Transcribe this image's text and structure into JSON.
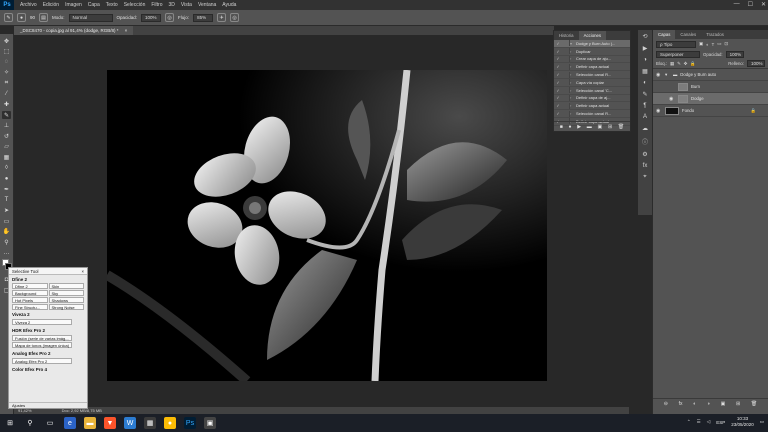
{
  "menubar": {
    "logo": "Ps",
    "items": [
      "Archivo",
      "Edición",
      "Imagen",
      "Capa",
      "Texto",
      "Selección",
      "Filtro",
      "3D",
      "Vista",
      "Ventana",
      "Ayuda"
    ],
    "window_controls": [
      "—",
      "☐",
      "✕"
    ]
  },
  "options": {
    "mode_label": "Modo:",
    "mode_value": "Normal",
    "opacity_label": "Opacidad:",
    "opacity_value": "100%",
    "flow_label": "Flujo:",
    "flow_value": "85%",
    "brush_size": "90"
  },
  "document": {
    "tab_title": "_DSC8470 - copia.jpg al 91,4% (dodge, RGB/8) *",
    "tab_close": "×"
  },
  "status": {
    "zoom": "91,42%",
    "doc_info": "Doc: 2,92 MB/8,75 MB"
  },
  "history_panel": {
    "tabs": [
      "Historia",
      "Acciones"
    ],
    "actions": [
      "Dodge y Burn Auto (...",
      "Duplicar",
      "Crear capa de aju...",
      "Definir capa actual",
      "Selección canal R...",
      "Capa vía copiar",
      "Selección canal 'C...",
      "Definir capa de aj...",
      "Definir capa actual",
      "Selección canal R...",
      "Definir capa actual"
    ],
    "footer_icons": [
      "■",
      "●",
      "▶",
      "▬",
      "▣",
      "⊞",
      "🗑"
    ]
  },
  "layers_panel": {
    "tabs": [
      "Capas",
      "Canales",
      "Trazados"
    ],
    "filter_label": "ρ Tipo",
    "blend_mode": "Superponer",
    "opacity_label": "Opacidad:",
    "opacity_value": "100%",
    "lock_label": "Bloq.:",
    "fill_label": "Relleno:",
    "fill_value": "100%",
    "layers": [
      {
        "name": "Dodge y Burn auto",
        "kind": "group"
      },
      {
        "name": "Burn",
        "kind": "layer"
      },
      {
        "name": "Dodge",
        "kind": "layer"
      },
      {
        "name": "Fondo",
        "kind": "background"
      }
    ],
    "footer_icons": [
      "⊖",
      "fx",
      "◐",
      "◑",
      "▣",
      "⊞",
      "🗑"
    ]
  },
  "selective_tool": {
    "title": "Selective Tool",
    "close": "×",
    "sections": [
      {
        "title": "Dfine 2",
        "buttons": [
          "Dfine 2",
          "Skin",
          "Background",
          "Sky",
          "Hot Pixels",
          "Shadows",
          "Fine Structu...",
          "Strong Noise"
        ]
      },
      {
        "title": "Viveza 2",
        "buttons": [
          "Viveza 2"
        ]
      },
      {
        "title": "HDR Efex Pro 2",
        "buttons": [
          "Fusión (serie de varias imág...",
          "Mapa de tonos (imagen única)"
        ]
      },
      {
        "title": "Analog Efex Pro 2",
        "buttons": [
          "Analog Efex Pro 2"
        ]
      },
      {
        "title": "Color Efex Pro 4",
        "buttons": []
      }
    ],
    "footer": "Ajustes"
  },
  "taskbar": {
    "time": "10:33",
    "date": "23/05/2020",
    "language": "ESP"
  }
}
